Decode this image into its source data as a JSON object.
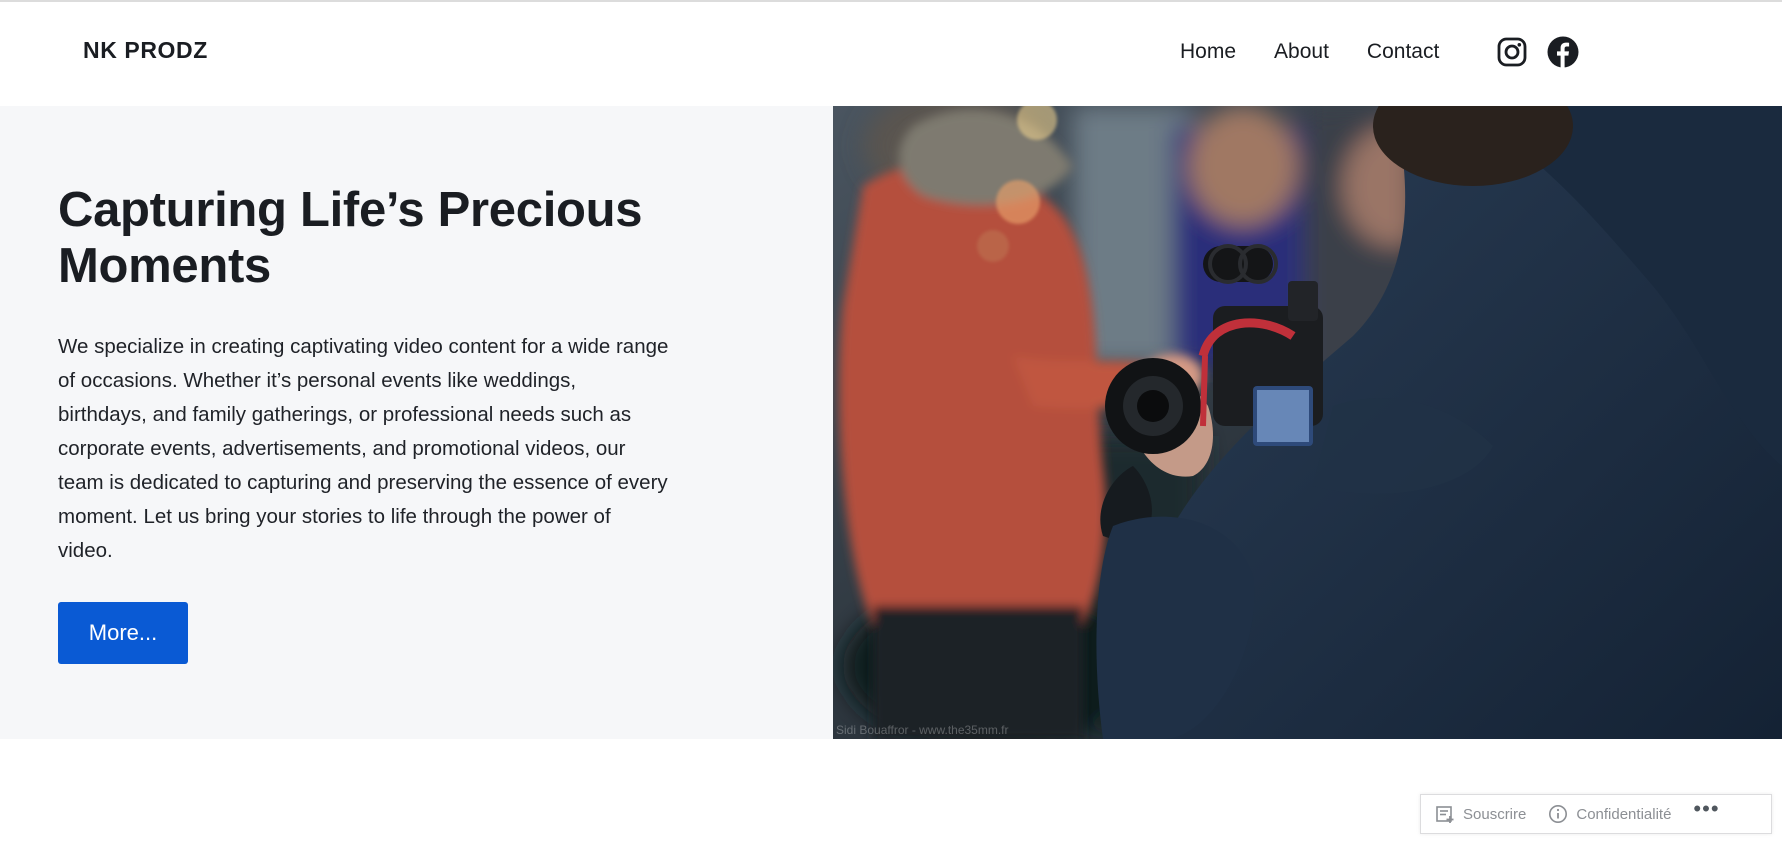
{
  "header": {
    "site_title": "NK PRODZ",
    "nav": [
      {
        "label": "Home"
      },
      {
        "label": "About"
      },
      {
        "label": "Contact"
      }
    ],
    "social": [
      {
        "icon": "instagram-icon"
      },
      {
        "icon": "facebook-icon"
      }
    ]
  },
  "hero": {
    "title": "Capturing Life’s Precious Moments",
    "text": "We specialize in creating captivating video content for a wide range of occasions. Whether it’s personal events like weddings, birthdays, and family gatherings, or professional needs such as corporate events, advertisements, and promotional videos, our team is dedicated to capturing and preserving the essence of every moment. Let us bring your stories to life through the power of video.",
    "button_label": "More...",
    "button_color": "#0a5ad4",
    "photo_credit": "Sidi Bouaffror - www.the35mm.fr"
  },
  "wp_bar": {
    "subscribe_label": "Souscrire",
    "privacy_label": "Confidentialité",
    "more_label": "•••"
  }
}
